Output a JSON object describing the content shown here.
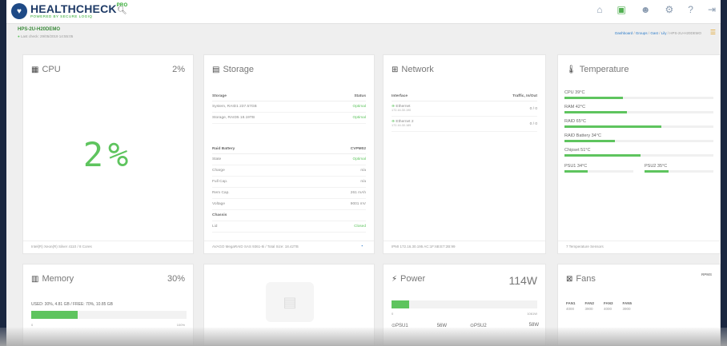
{
  "app": {
    "name": "HEALTHCHECK",
    "edition": "PRO",
    "tagline": "POWERED BY SECURE LOGIQ"
  },
  "header": {
    "search_icon": "search-icon",
    "icons": [
      "home-icon",
      "dashboard-icon",
      "users-icon",
      "gear-icon",
      "help-icon",
      "logout-icon"
    ],
    "host": "HPS-2U-H20DEMO",
    "last_check": "Last check: 29/05/2019 14:55:05",
    "breadcrumb": [
      "Dashboard",
      "Groups",
      "Gast",
      "Lily",
      "HPS-2U-H20DEMO"
    ]
  },
  "cpu": {
    "title": "CPU",
    "value": "2%",
    "big": "2%",
    "footer": "Intel(R) Xeon(R) Silver 4110 / 8 Cores"
  },
  "storage": {
    "title": "Storage",
    "col_storage": "Storage",
    "col_status": "Status",
    "rows": [
      {
        "name": "System, RAID1 237.57GB",
        "status": "Optimal"
      },
      {
        "name": "Storage, RAID5 18.19TB",
        "status": "Optimal"
      }
    ],
    "battery_label": "Raid Battery",
    "battery_model": "CVPM02",
    "battery_rows": [
      {
        "k": "State",
        "v": "Optimal"
      },
      {
        "k": "Charge",
        "v": "n/a"
      },
      {
        "k": "Full Cap.",
        "v": "n/a"
      },
      {
        "k": "Rem Cap.",
        "v": "261 mAh"
      },
      {
        "k": "Voltage",
        "v": "9001 mV"
      }
    ],
    "chassis_label": "Chassis",
    "lid_label": "Lid",
    "lid_value": "Closed",
    "footer": "AVAGO MegaRAID SAS 9361-8i / Total Size: 18.42TB"
  },
  "network": {
    "title": "Network",
    "col_interface": "Interface",
    "col_traffic": "Traffic, In/Out",
    "interfaces": [
      {
        "name": "Ethernet",
        "ip": "172.16.30.190",
        "traffic": "0 / 0"
      },
      {
        "name": "Ethernet 2",
        "ip": "172.16.30.189",
        "traffic": "0 / 0"
      }
    ],
    "footer": "IPMI 172.16.30.195 AC:1F:6B:E7:2B:99"
  },
  "temperature": {
    "title": "Temperature",
    "sensors": [
      {
        "label": "CPU 39°C",
        "level": 0.39
      },
      {
        "label": "RAM 42°C",
        "level": 0.42
      },
      {
        "label": "RAID 65°C",
        "level": 0.65
      },
      {
        "label": "RAID Battery 34°C",
        "level": 0.34
      },
      {
        "label": "Chipset 51°C",
        "level": 0.51
      }
    ],
    "psu": [
      {
        "label": "PSU1 34°C",
        "level": 0.34
      },
      {
        "label": "PSU2 35°C",
        "level": 0.35
      }
    ],
    "footer": "7 Temperature Sensors"
  },
  "memory": {
    "title": "Memory",
    "value": "30%",
    "used_text": "USED: 30%, 4.81 GB / FREE: 70%, 10.85 GB",
    "level": 0.3,
    "min": "0",
    "max": "100%"
  },
  "power": {
    "title": "Power",
    "value": "114W",
    "level": 0.107,
    "min": "0",
    "max": "1061W",
    "psu1_label": "PSU1",
    "psu1_value": "56W",
    "psu2_label": "PSU2",
    "psu2_value": "58W"
  },
  "fans": {
    "title": "Fans",
    "unit": "RPMS",
    "items": [
      {
        "name": "FAN1",
        "rpm": "4000"
      },
      {
        "name": "FAN2",
        "rpm": "3900"
      },
      {
        "name": "FAN3",
        "rpm": "4000"
      },
      {
        "name": "FAN5",
        "rpm": "3900"
      }
    ]
  },
  "colors": {
    "accent": "#5ec45e",
    "brand": "#1e3a66",
    "link": "#2a7ac8",
    "page_bg": "#efefef"
  }
}
